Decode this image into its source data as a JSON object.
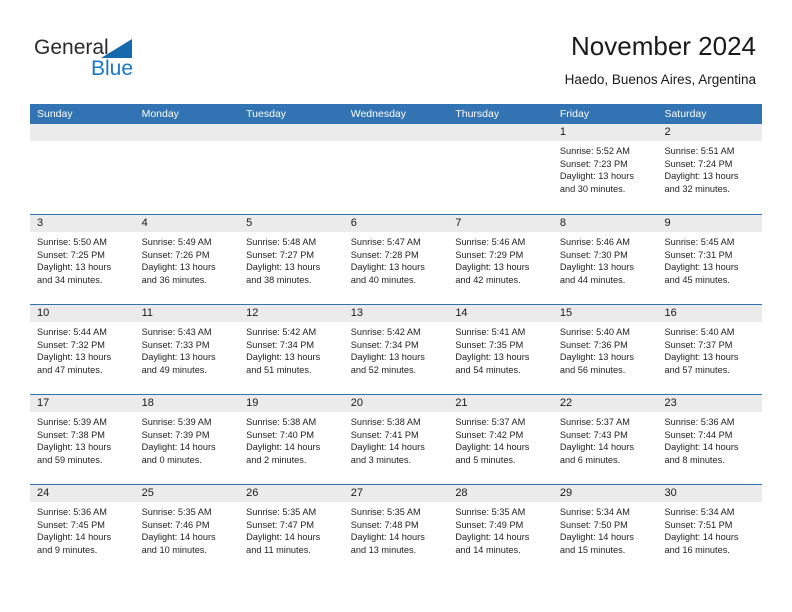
{
  "brand": {
    "name_part1": "General",
    "name_part2": "Blue",
    "triangle_icon": "triangle-icon",
    "accent_color": "#1569ad",
    "blue_text_color": "#1878c8"
  },
  "header": {
    "title": "November 2024",
    "location": "Haedo, Buenos Aires, Argentina",
    "header_bg_color": "#3273b4",
    "daynum_bg_color": "#ebebeb"
  },
  "calendar": {
    "weekday_headers": [
      "Sunday",
      "Monday",
      "Tuesday",
      "Wednesday",
      "Thursday",
      "Friday",
      "Saturday"
    ],
    "weeks": [
      [
        {
          "day": "",
          "sunrise": "",
          "sunset": "",
          "daylight_line1": "",
          "daylight_line2": "",
          "empty": true
        },
        {
          "day": "",
          "sunrise": "",
          "sunset": "",
          "daylight_line1": "",
          "daylight_line2": "",
          "empty": true
        },
        {
          "day": "",
          "sunrise": "",
          "sunset": "",
          "daylight_line1": "",
          "daylight_line2": "",
          "empty": true
        },
        {
          "day": "",
          "sunrise": "",
          "sunset": "",
          "daylight_line1": "",
          "daylight_line2": "",
          "empty": true
        },
        {
          "day": "",
          "sunrise": "",
          "sunset": "",
          "daylight_line1": "",
          "daylight_line2": "",
          "empty": true
        },
        {
          "day": "1",
          "sunrise": "Sunrise: 5:52 AM",
          "sunset": "Sunset: 7:23 PM",
          "daylight_line1": "Daylight: 13 hours",
          "daylight_line2": "and 30 minutes.",
          "empty": false
        },
        {
          "day": "2",
          "sunrise": "Sunrise: 5:51 AM",
          "sunset": "Sunset: 7:24 PM",
          "daylight_line1": "Daylight: 13 hours",
          "daylight_line2": "and 32 minutes.",
          "empty": false
        }
      ],
      [
        {
          "day": "3",
          "sunrise": "Sunrise: 5:50 AM",
          "sunset": "Sunset: 7:25 PM",
          "daylight_line1": "Daylight: 13 hours",
          "daylight_line2": "and 34 minutes.",
          "empty": false
        },
        {
          "day": "4",
          "sunrise": "Sunrise: 5:49 AM",
          "sunset": "Sunset: 7:26 PM",
          "daylight_line1": "Daylight: 13 hours",
          "daylight_line2": "and 36 minutes.",
          "empty": false
        },
        {
          "day": "5",
          "sunrise": "Sunrise: 5:48 AM",
          "sunset": "Sunset: 7:27 PM",
          "daylight_line1": "Daylight: 13 hours",
          "daylight_line2": "and 38 minutes.",
          "empty": false
        },
        {
          "day": "6",
          "sunrise": "Sunrise: 5:47 AM",
          "sunset": "Sunset: 7:28 PM",
          "daylight_line1": "Daylight: 13 hours",
          "daylight_line2": "and 40 minutes.",
          "empty": false
        },
        {
          "day": "7",
          "sunrise": "Sunrise: 5:46 AM",
          "sunset": "Sunset: 7:29 PM",
          "daylight_line1": "Daylight: 13 hours",
          "daylight_line2": "and 42 minutes.",
          "empty": false
        },
        {
          "day": "8",
          "sunrise": "Sunrise: 5:46 AM",
          "sunset": "Sunset: 7:30 PM",
          "daylight_line1": "Daylight: 13 hours",
          "daylight_line2": "and 44 minutes.",
          "empty": false
        },
        {
          "day": "9",
          "sunrise": "Sunrise: 5:45 AM",
          "sunset": "Sunset: 7:31 PM",
          "daylight_line1": "Daylight: 13 hours",
          "daylight_line2": "and 45 minutes.",
          "empty": false
        }
      ],
      [
        {
          "day": "10",
          "sunrise": "Sunrise: 5:44 AM",
          "sunset": "Sunset: 7:32 PM",
          "daylight_line1": "Daylight: 13 hours",
          "daylight_line2": "and 47 minutes.",
          "empty": false
        },
        {
          "day": "11",
          "sunrise": "Sunrise: 5:43 AM",
          "sunset": "Sunset: 7:33 PM",
          "daylight_line1": "Daylight: 13 hours",
          "daylight_line2": "and 49 minutes.",
          "empty": false
        },
        {
          "day": "12",
          "sunrise": "Sunrise: 5:42 AM",
          "sunset": "Sunset: 7:34 PM",
          "daylight_line1": "Daylight: 13 hours",
          "daylight_line2": "and 51 minutes.",
          "empty": false
        },
        {
          "day": "13",
          "sunrise": "Sunrise: 5:42 AM",
          "sunset": "Sunset: 7:34 PM",
          "daylight_line1": "Daylight: 13 hours",
          "daylight_line2": "and 52 minutes.",
          "empty": false
        },
        {
          "day": "14",
          "sunrise": "Sunrise: 5:41 AM",
          "sunset": "Sunset: 7:35 PM",
          "daylight_line1": "Daylight: 13 hours",
          "daylight_line2": "and 54 minutes.",
          "empty": false
        },
        {
          "day": "15",
          "sunrise": "Sunrise: 5:40 AM",
          "sunset": "Sunset: 7:36 PM",
          "daylight_line1": "Daylight: 13 hours",
          "daylight_line2": "and 56 minutes.",
          "empty": false
        },
        {
          "day": "16",
          "sunrise": "Sunrise: 5:40 AM",
          "sunset": "Sunset: 7:37 PM",
          "daylight_line1": "Daylight: 13 hours",
          "daylight_line2": "and 57 minutes.",
          "empty": false
        }
      ],
      [
        {
          "day": "17",
          "sunrise": "Sunrise: 5:39 AM",
          "sunset": "Sunset: 7:38 PM",
          "daylight_line1": "Daylight: 13 hours",
          "daylight_line2": "and 59 minutes.",
          "empty": false
        },
        {
          "day": "18",
          "sunrise": "Sunrise: 5:39 AM",
          "sunset": "Sunset: 7:39 PM",
          "daylight_line1": "Daylight: 14 hours",
          "daylight_line2": "and 0 minutes.",
          "empty": false
        },
        {
          "day": "19",
          "sunrise": "Sunrise: 5:38 AM",
          "sunset": "Sunset: 7:40 PM",
          "daylight_line1": "Daylight: 14 hours",
          "daylight_line2": "and 2 minutes.",
          "empty": false
        },
        {
          "day": "20",
          "sunrise": "Sunrise: 5:38 AM",
          "sunset": "Sunset: 7:41 PM",
          "daylight_line1": "Daylight: 14 hours",
          "daylight_line2": "and 3 minutes.",
          "empty": false
        },
        {
          "day": "21",
          "sunrise": "Sunrise: 5:37 AM",
          "sunset": "Sunset: 7:42 PM",
          "daylight_line1": "Daylight: 14 hours",
          "daylight_line2": "and 5 minutes.",
          "empty": false
        },
        {
          "day": "22",
          "sunrise": "Sunrise: 5:37 AM",
          "sunset": "Sunset: 7:43 PM",
          "daylight_line1": "Daylight: 14 hours",
          "daylight_line2": "and 6 minutes.",
          "empty": false
        },
        {
          "day": "23",
          "sunrise": "Sunrise: 5:36 AM",
          "sunset": "Sunset: 7:44 PM",
          "daylight_line1": "Daylight: 14 hours",
          "daylight_line2": "and 8 minutes.",
          "empty": false
        }
      ],
      [
        {
          "day": "24",
          "sunrise": "Sunrise: 5:36 AM",
          "sunset": "Sunset: 7:45 PM",
          "daylight_line1": "Daylight: 14 hours",
          "daylight_line2": "and 9 minutes.",
          "empty": false
        },
        {
          "day": "25",
          "sunrise": "Sunrise: 5:35 AM",
          "sunset": "Sunset: 7:46 PM",
          "daylight_line1": "Daylight: 14 hours",
          "daylight_line2": "and 10 minutes.",
          "empty": false
        },
        {
          "day": "26",
          "sunrise": "Sunrise: 5:35 AM",
          "sunset": "Sunset: 7:47 PM",
          "daylight_line1": "Daylight: 14 hours",
          "daylight_line2": "and 11 minutes.",
          "empty": false
        },
        {
          "day": "27",
          "sunrise": "Sunrise: 5:35 AM",
          "sunset": "Sunset: 7:48 PM",
          "daylight_line1": "Daylight: 14 hours",
          "daylight_line2": "and 13 minutes.",
          "empty": false
        },
        {
          "day": "28",
          "sunrise": "Sunrise: 5:35 AM",
          "sunset": "Sunset: 7:49 PM",
          "daylight_line1": "Daylight: 14 hours",
          "daylight_line2": "and 14 minutes.",
          "empty": false
        },
        {
          "day": "29",
          "sunrise": "Sunrise: 5:34 AM",
          "sunset": "Sunset: 7:50 PM",
          "daylight_line1": "Daylight: 14 hours",
          "daylight_line2": "and 15 minutes.",
          "empty": false
        },
        {
          "day": "30",
          "sunrise": "Sunrise: 5:34 AM",
          "sunset": "Sunset: 7:51 PM",
          "daylight_line1": "Daylight: 14 hours",
          "daylight_line2": "and 16 minutes.",
          "empty": false
        }
      ]
    ]
  }
}
